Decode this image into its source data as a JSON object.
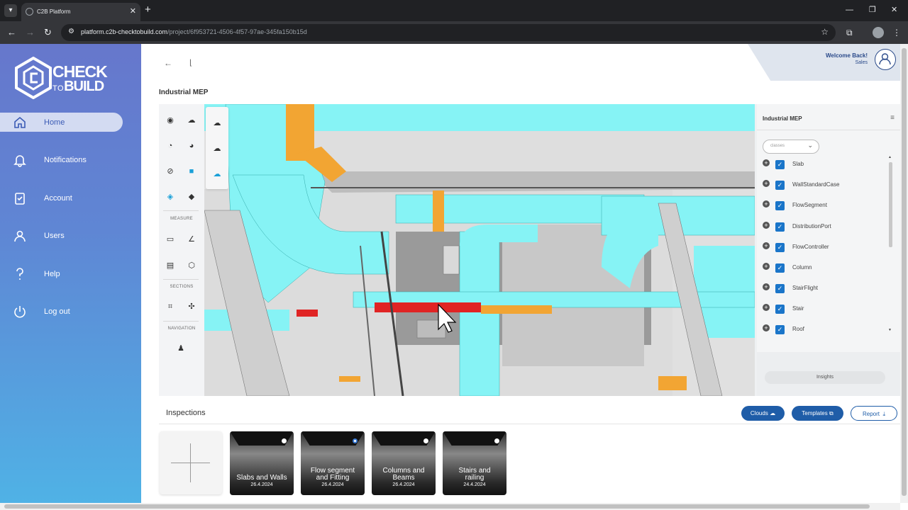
{
  "browser": {
    "tab_title": "C2B Platform",
    "url_host": "platform.c2b-checktobuild.com",
    "url_path": "/project/6f953721-4506-4f57-97ae-345fa150b15d"
  },
  "logo": {
    "line1": "CHECK",
    "line2a": "TO",
    "line2b": "BUILD"
  },
  "sidebar": {
    "items": [
      {
        "label": "Home",
        "icon": "home-icon",
        "active": true
      },
      {
        "label": "Notifications",
        "icon": "bell-icon"
      },
      {
        "label": "Account",
        "icon": "clipboard-icon"
      },
      {
        "label": "Users",
        "icon": "user-icon"
      },
      {
        "label": "Help",
        "icon": "help-icon"
      },
      {
        "label": "Log out",
        "icon": "power-icon"
      }
    ]
  },
  "header": {
    "welcome": "Welcome Back!",
    "user": "Sales"
  },
  "project": {
    "title": "Industrial MEP"
  },
  "viewer_tools": {
    "measure_caption": "MEASURE",
    "sections_caption": "SECTIONS",
    "navigation_caption": "NAVIGATION"
  },
  "model_panel": {
    "title": "Industrial MEP",
    "select_placeholder": "classes",
    "classes": [
      "Slab",
      "WallStandardCase",
      "FlowSegment",
      "DistributionPort",
      "FlowController",
      "Column",
      "StairFlight",
      "Stair",
      "Roof"
    ],
    "insights_label": "Insights"
  },
  "inspections": {
    "title": "Inspections",
    "clouds_label": "Clouds",
    "templates_label": "Templates",
    "report_label": "Report",
    "cards": [
      {
        "name_lines": [
          "Slabs and Walls"
        ],
        "date": "26.4.2024",
        "selected": false
      },
      {
        "name_lines": [
          "Flow segment",
          "and Fitting"
        ],
        "date": "26.4.2024",
        "selected": true
      },
      {
        "name_lines": [
          "Columns and",
          "Beams"
        ],
        "date": "26.4.2024",
        "selected": false
      },
      {
        "name_lines": [
          "Stairs and",
          "railing"
        ],
        "date": "24.4.2024",
        "selected": false
      }
    ]
  },
  "colors": {
    "accent": "#1f5da8",
    "pipe_cyan": "#7ef4f6",
    "pipe_orange": "#f2a533",
    "pipe_red": "#e02424"
  }
}
